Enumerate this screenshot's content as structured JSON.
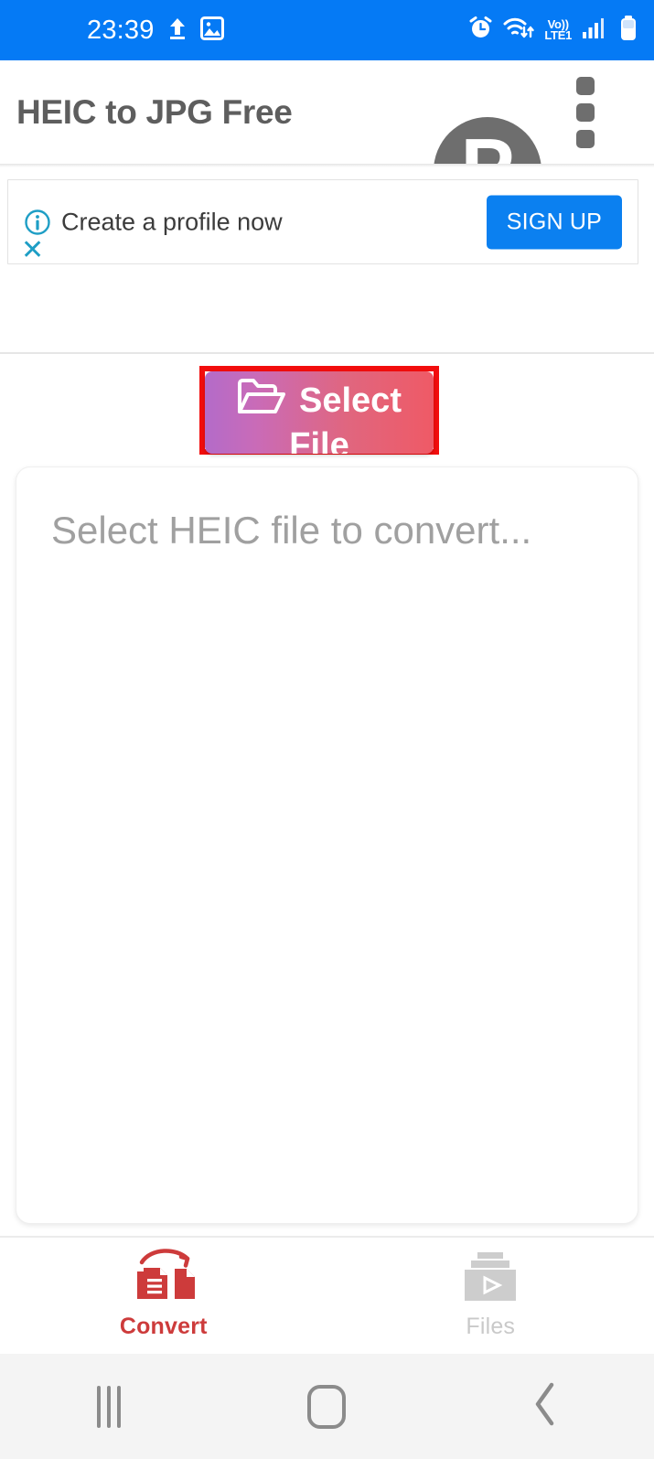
{
  "status_bar": {
    "time": "23:39",
    "background_color": "#057af5",
    "icons": [
      "upload-icon",
      "image-icon",
      "alarm-icon",
      "wifi-icon",
      "volte-icon",
      "signal-icon",
      "battery-icon"
    ],
    "network_label_top": "Vo))",
    "network_label_bottom": "LTE1"
  },
  "app_bar": {
    "title": "HEIC to JPG Free",
    "title_color": "#5e5e5e",
    "avatar_letter": "P",
    "avatar_color": "#6e6e6e",
    "overflow_menu": "more-options"
  },
  "ad": {
    "text": "Create a profile now",
    "button_label": "SIGN UP",
    "button_color": "#0b80f0",
    "info_icon": "info-icon",
    "close_icon": "close-icon",
    "accent_color": "#1e9ec5"
  },
  "select_file": {
    "icon": "folder-open-icon",
    "label_line1": "Select",
    "label_line2": "File",
    "gradient_start": "#b36bc9",
    "gradient_end": "#ef5a66",
    "highlight_color": "#f20d0d"
  },
  "content": {
    "placeholder": "Select HEIC file to convert...",
    "placeholder_color": "#a0a0a0"
  },
  "bottom_tabs": [
    {
      "label": "Convert",
      "icon": "convert-documents-icon",
      "color": "#cd3b3b",
      "active": true
    },
    {
      "label": "Files",
      "icon": "files-stack-icon",
      "color": "#c9c9c9",
      "active": false
    }
  ],
  "nav_bar": {
    "recents": "recents-icon",
    "home": "home-icon",
    "back": "back-icon",
    "background_color": "#f4f4f4"
  }
}
